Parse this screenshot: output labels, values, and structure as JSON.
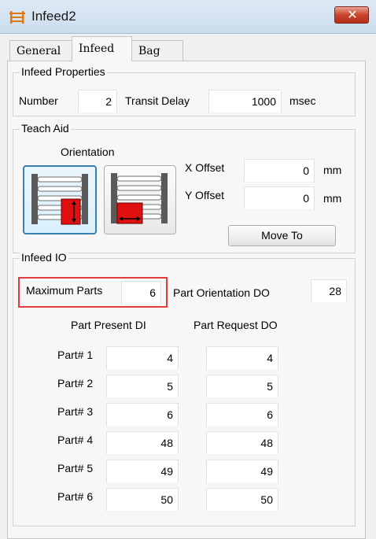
{
  "window": {
    "title": "Infeed2",
    "close_symbol": "✕"
  },
  "tabs": [
    {
      "label": "General",
      "active": false
    },
    {
      "label": "Infeed",
      "active": true
    },
    {
      "label": "Bag",
      "active": false
    }
  ],
  "infeed_properties": {
    "title": "Infeed Properties",
    "number_label": "Number",
    "number_value": "2",
    "transit_delay_label": "Transit Delay",
    "transit_delay_value": "1000",
    "transit_delay_unit": "msec"
  },
  "teach_aid": {
    "title": "Teach Aid",
    "orientation_label": "Orientation",
    "orientation_selected": "left",
    "x_offset_label": "X Offset",
    "x_offset_value": "0",
    "x_offset_unit": "mm",
    "y_offset_label": "Y Offset",
    "y_offset_value": "0",
    "y_offset_unit": "mm",
    "move_to_label": "Move To"
  },
  "infeed_io": {
    "title": "Infeed IO",
    "max_parts_label": "Maximum Parts",
    "max_parts_value": "6",
    "part_orientation_label": "Part Orientation DO",
    "part_orientation_value": "28",
    "col_present": "Part Present DI",
    "col_request": "Part Request DO",
    "rows": [
      {
        "label": "Part# 1",
        "present": "4",
        "request": "4"
      },
      {
        "label": "Part# 2",
        "present": "5",
        "request": "5"
      },
      {
        "label": "Part# 3",
        "present": "6",
        "request": "6"
      },
      {
        "label": "Part# 4",
        "present": "48",
        "request": "48"
      },
      {
        "label": "Part# 5",
        "present": "49",
        "request": "49"
      },
      {
        "label": "Part# 6",
        "present": "50",
        "request": "50"
      }
    ]
  },
  "colors": {
    "highlight": "#e23c3c",
    "accent": "#e07a10",
    "part_red": "#e01010"
  }
}
